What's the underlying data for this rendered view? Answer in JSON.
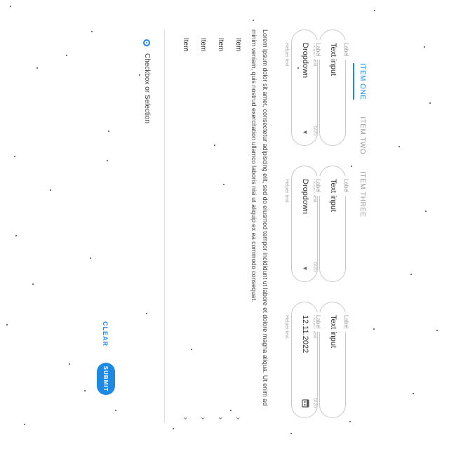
{
  "tabs": [
    {
      "label": "ITEM ONE"
    },
    {
      "label": "ITEM TWO"
    },
    {
      "label": "ITEM THREE"
    }
  ],
  "form": {
    "row1": [
      {
        "label": "Label",
        "value": "Text input",
        "count": "0/20",
        "helper": "Helper text"
      },
      {
        "label": "Label",
        "value": "Text input",
        "count": "0/20",
        "helper": "Helper text"
      },
      {
        "label": "Label",
        "value": "Text input",
        "count": "0/20",
        "helper": "Helper text"
      }
    ],
    "row2": [
      {
        "label": "Label",
        "value": "Dropdown",
        "helper": "Helper text"
      },
      {
        "label": "Label",
        "value": "Dropdown",
        "helper": "Helper text"
      },
      {
        "label": "Label",
        "value": "12.11.2022",
        "helper": "Helper text",
        "icon": "calendar-icon"
      }
    ]
  },
  "paragraph": "Lorem ipsum dolor sit amet, consectetur adipiscing elit, sed do eiusmod tempor incididunt ut labore et dolore magna aliqua. Ut enim ad minim veniam, quis nostrud exercitation ullamco laboris nisi ut aliquip ex ea commodo consequat.",
  "list_items": [
    {
      "label": "Item"
    },
    {
      "label": "Item"
    },
    {
      "label": "Item"
    },
    {
      "label": "Item"
    }
  ],
  "checkbox": {
    "label": "Checkbox or Selection",
    "selected": true
  },
  "actions": {
    "clear": "CLEAR",
    "submit": "SUBMIT"
  },
  "colors": {
    "accent": "#1e88e5"
  }
}
